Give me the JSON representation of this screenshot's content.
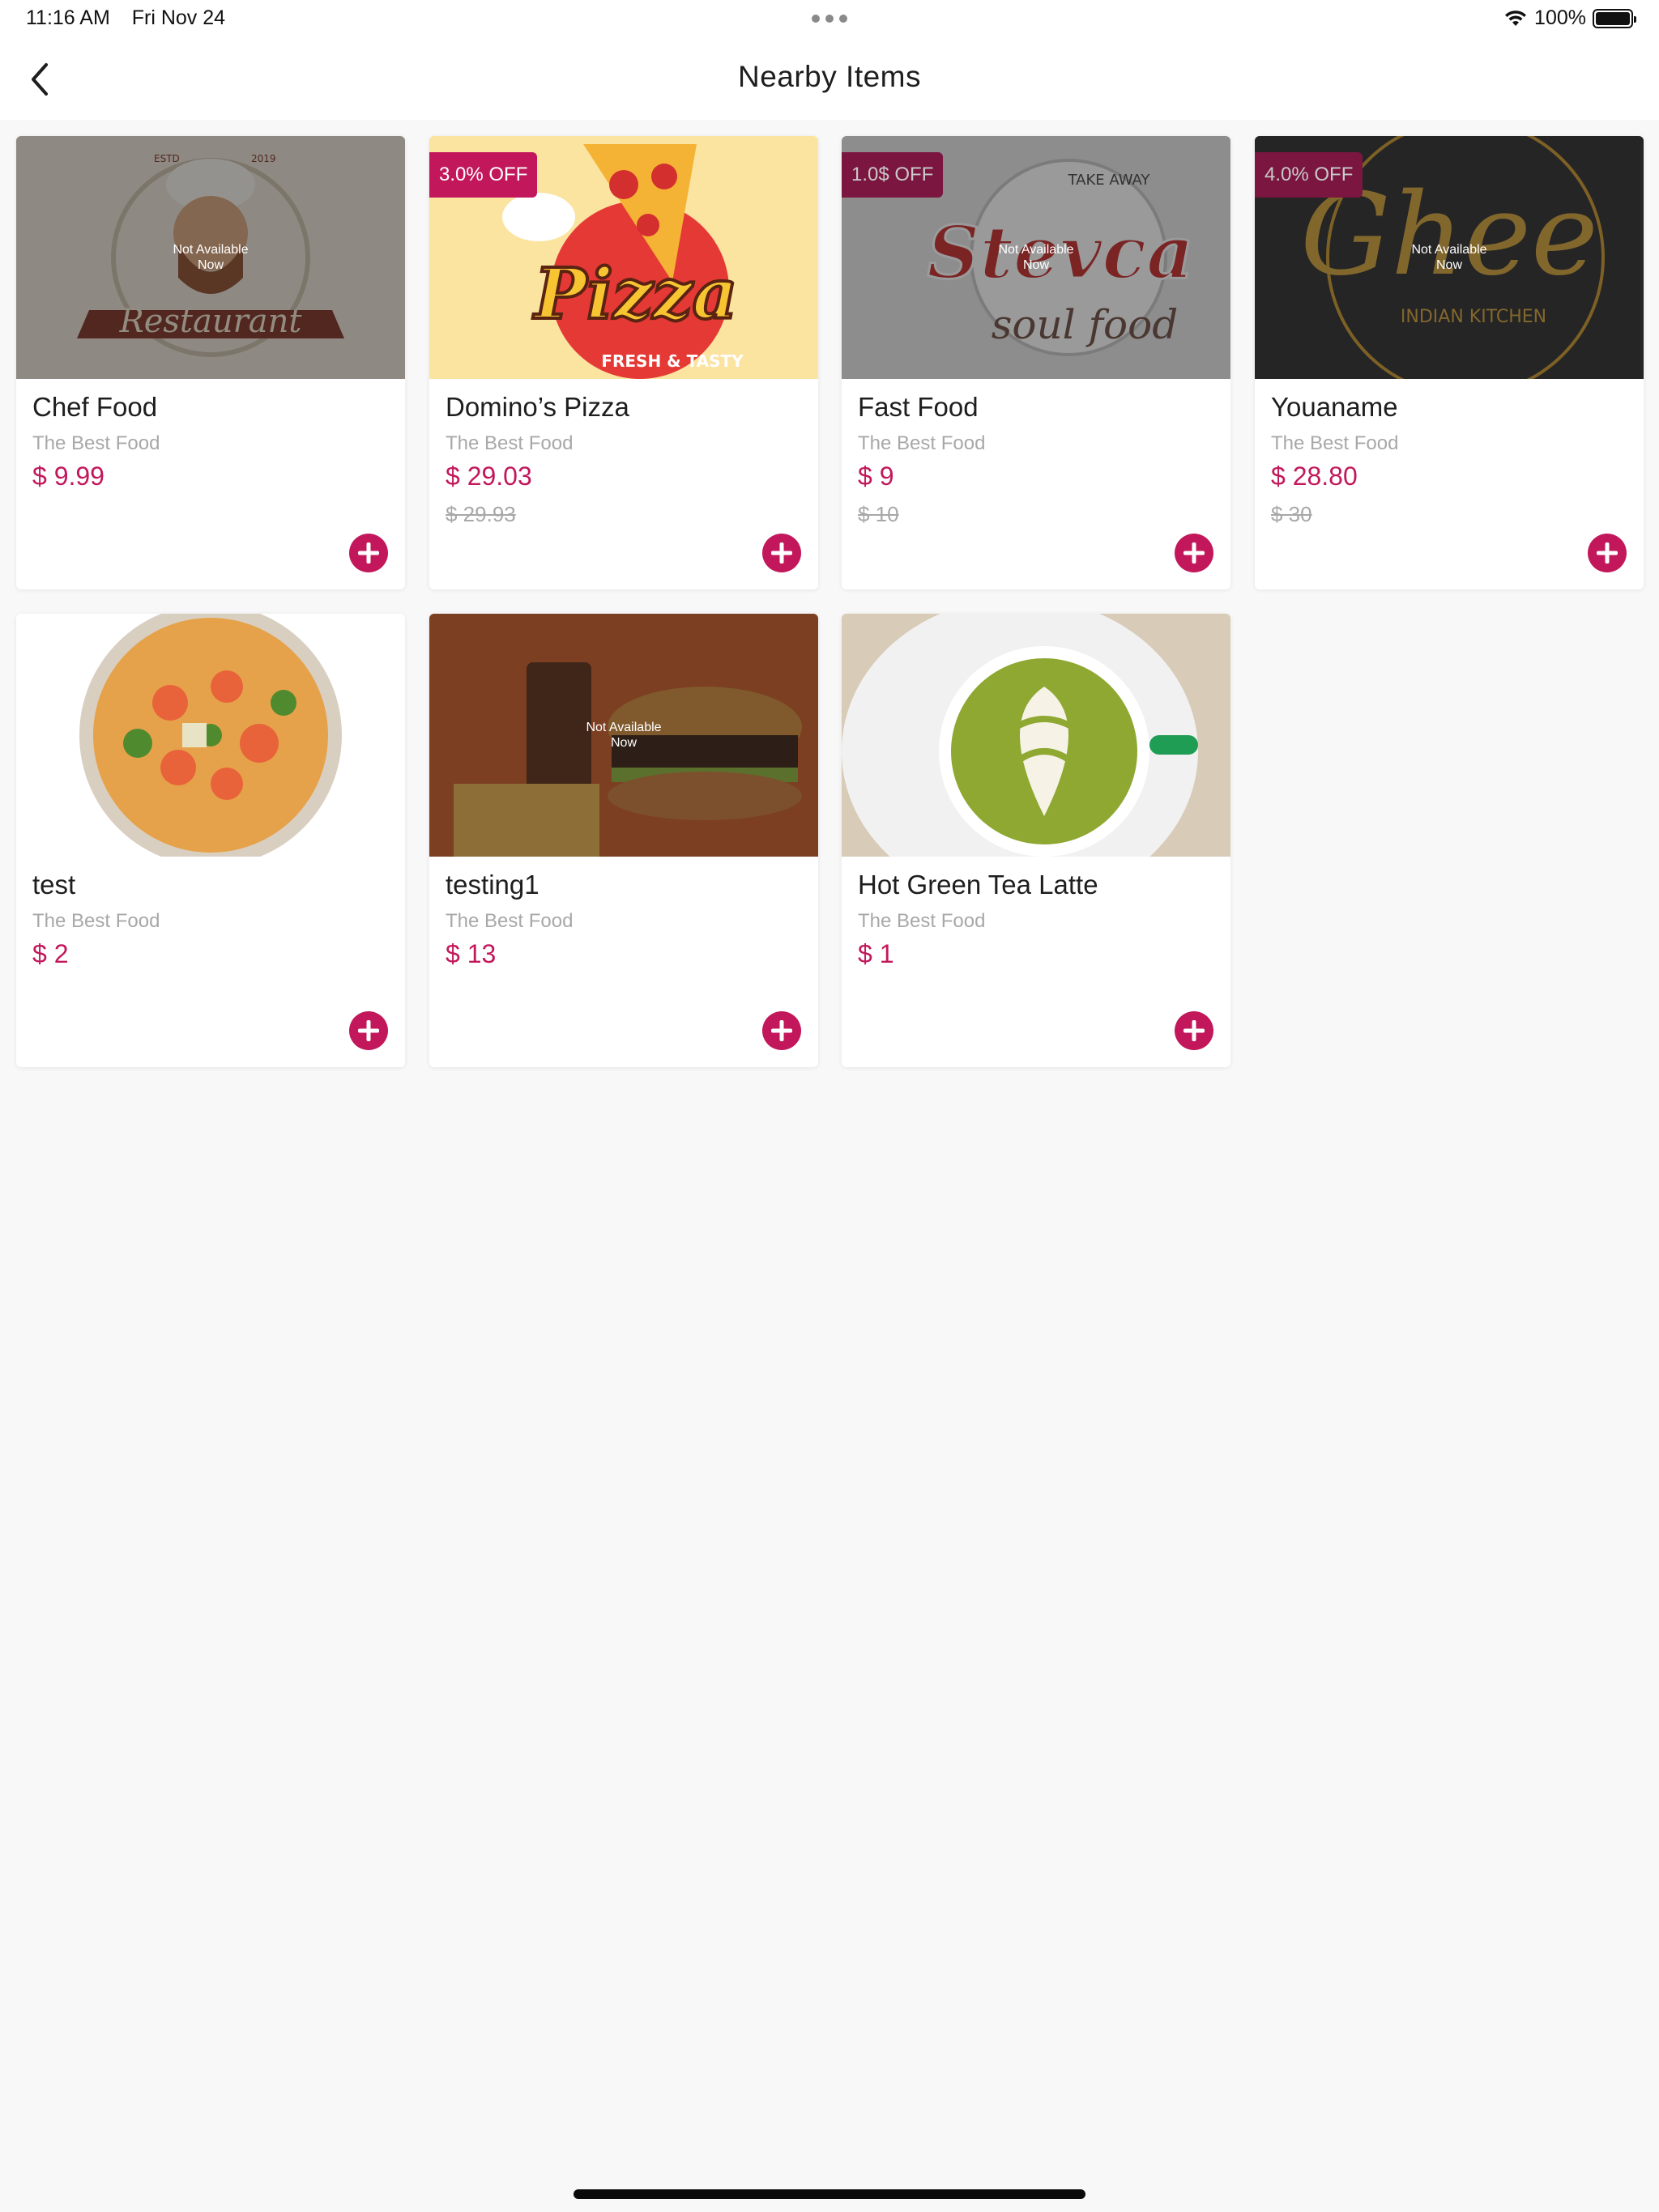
{
  "status": {
    "time": "11:16 AM",
    "date": "Fri Nov 24",
    "battery": "100%"
  },
  "nav": {
    "title": "Nearby Items",
    "back_icon": "chevron-left-icon"
  },
  "colors": {
    "accent": "#c2185b",
    "muted": "#a8a8a8",
    "background": "#f8f8f8"
  },
  "items": [
    {
      "name": "Chef Food",
      "subtitle": "The Best Food",
      "price": "$ 9.99",
      "old_price": "",
      "discount": "",
      "unavailable": "Not Available Now"
    },
    {
      "name": "Domino’s Pizza",
      "subtitle": "The Best Food",
      "price": "$ 29.03",
      "old_price": "$ 29.93",
      "discount": "3.0% OFF",
      "unavailable": ""
    },
    {
      "name": "Fast Food",
      "subtitle": "The Best Food",
      "price": "$ 9",
      "old_price": "$ 10",
      "discount": "1.0$ OFF",
      "unavailable": "Not Available Now"
    },
    {
      "name": "Youaname",
      "subtitle": "The Best Food",
      "price": "$ 28.80",
      "old_price": "$ 30",
      "discount": "4.0% OFF",
      "unavailable": "Not Available Now"
    },
    {
      "name": "test",
      "subtitle": "The Best Food",
      "price": "$ 2",
      "old_price": "",
      "discount": "",
      "unavailable": ""
    },
    {
      "name": "testing1",
      "subtitle": "The Best Food",
      "price": "$ 13",
      "old_price": "",
      "discount": "",
      "unavailable": "Not Available Now"
    },
    {
      "name": "Hot Green Tea Latte",
      "subtitle": "The Best Food",
      "price": "$ 1",
      "old_price": "",
      "discount": "",
      "unavailable": ""
    }
  ]
}
